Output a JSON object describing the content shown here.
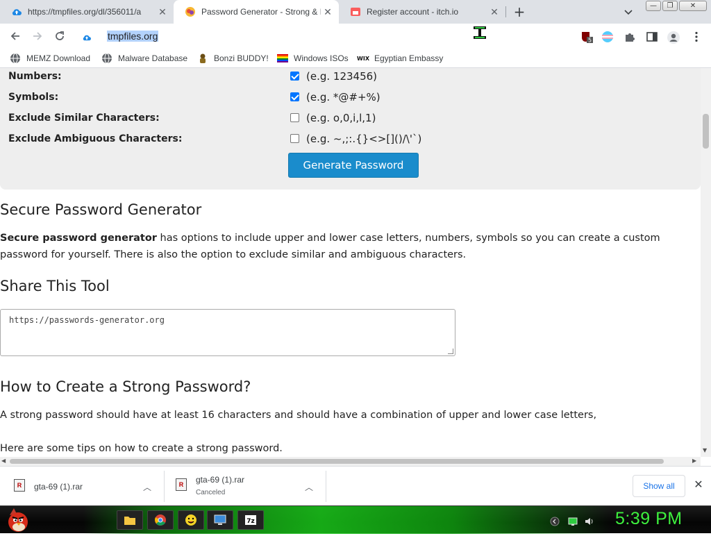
{
  "tabs": [
    {
      "title": "https://tmpfiles.org/dl/356011/a",
      "icon": "cloud-upload-icon"
    },
    {
      "title": "Password Generator - Strong & R",
      "icon": "padlock-icon"
    },
    {
      "title": "Register account - itch.io",
      "icon": "itch-io-icon"
    }
  ],
  "toolbar": {
    "url": "tmpfiles.org"
  },
  "bookmarks": [
    {
      "label": "MEMZ Download"
    },
    {
      "label": "Malware Database"
    },
    {
      "label": "Bonzi BUDDY!"
    },
    {
      "label": "Windows ISOs"
    },
    {
      "label": "Egyptian Embassy"
    }
  ],
  "form": {
    "options": [
      {
        "label": "Numbers:",
        "example": "(e.g. 123456)",
        "checked": true
      },
      {
        "label": "Symbols:",
        "example": "(e.g. *@#+%)",
        "checked": true
      },
      {
        "label": "Exclude Similar Characters:",
        "example": "(e.g. o,0,i,l,1)",
        "checked": false
      },
      {
        "label": "Exclude Ambiguous Characters:",
        "example": "(e.g. ~,;:.{}<>[]()/\\'`)",
        "checked": false
      }
    ],
    "generate_label": "Generate Password"
  },
  "content": {
    "heading1": "Secure Password Generator",
    "para1_bold": "Secure password generator",
    "para1_rest": " has options to include upper and lower case letters, numbers, symbols so you can create a custom password for yourself. There is also the option to exclude similar and ambiguous characters.",
    "heading2": "Share This Tool",
    "share_url": "https://passwords-generator.org",
    "heading3": "How to Create a Strong Password?",
    "para2": "A strong password should have at least 16 characters and should have a combination of upper and lower case letters,",
    "para3": "Here are some tips on how to create a strong password."
  },
  "downloads": [
    {
      "name": "gta-69 (1).rar",
      "status": ""
    },
    {
      "name": "gta-69 (1).rar",
      "status": "Canceled"
    }
  ],
  "shelf": {
    "show_all": "Show all"
  },
  "taskbar": {
    "clock": "5:39 PM"
  },
  "colors": {
    "accent": "#1a8ccc",
    "clock": "#3ef03e",
    "taskbar_glow": "#19c619"
  }
}
